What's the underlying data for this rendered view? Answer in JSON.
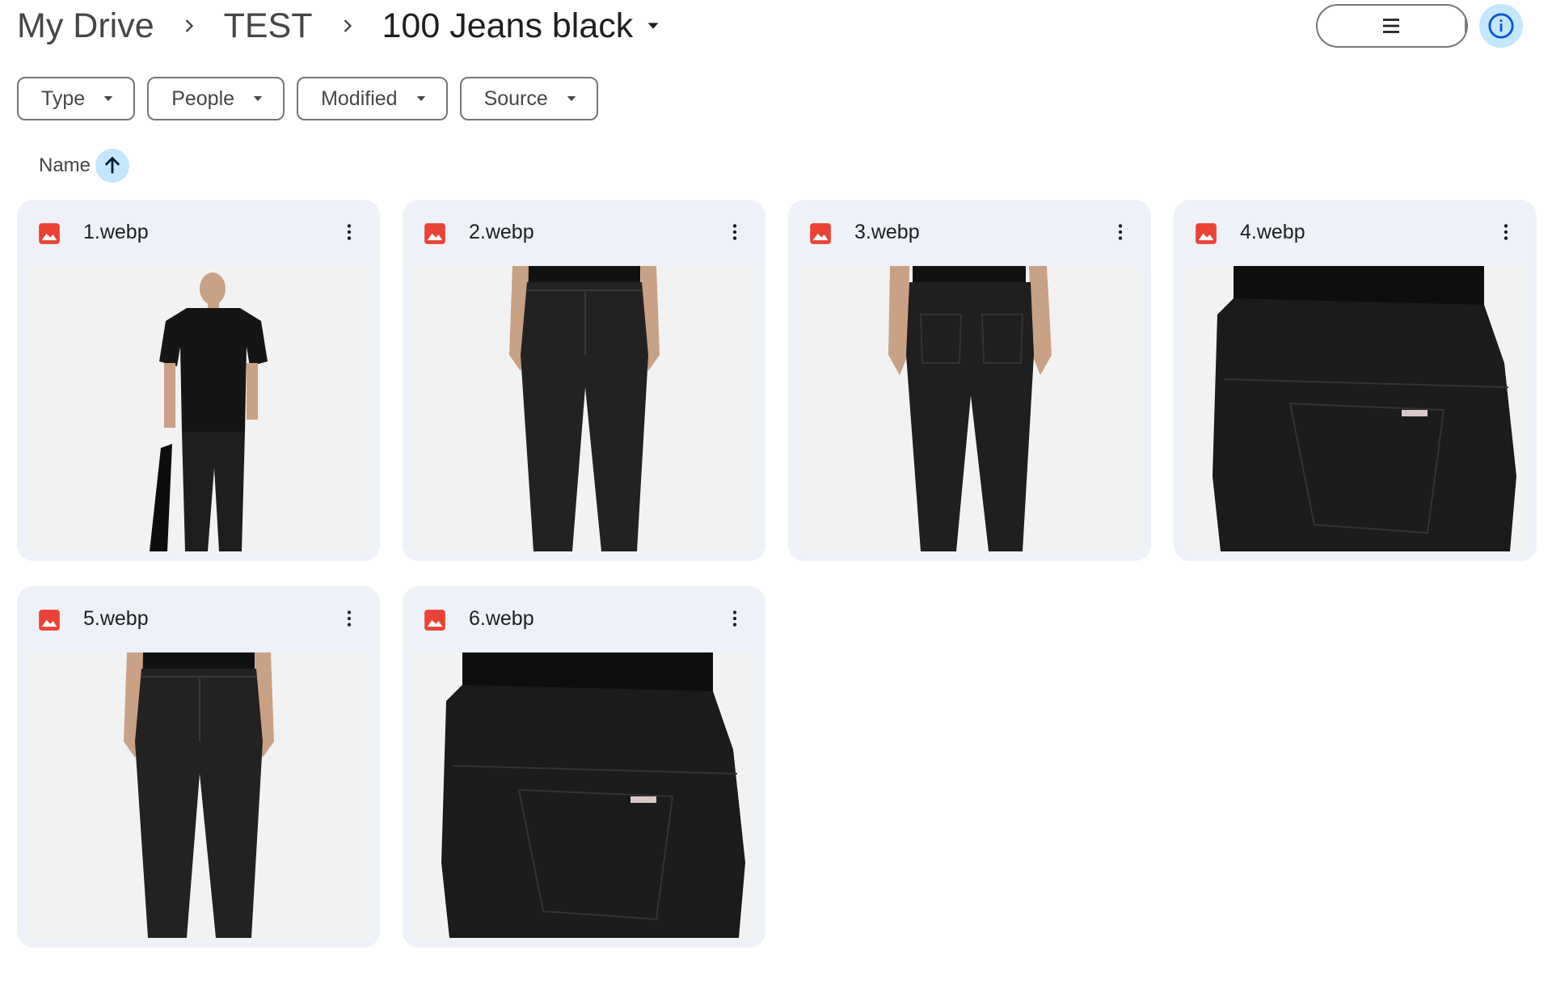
{
  "breadcrumb": {
    "items": [
      "My Drive",
      "TEST"
    ],
    "current": "100 Jeans black"
  },
  "view_toggle": {
    "list_icon": "list-icon",
    "grid_icon": "grid-icon",
    "selected": "grid"
  },
  "info_icon": "info-icon",
  "filters": [
    {
      "label": "Type"
    },
    {
      "label": "People"
    },
    {
      "label": "Modified"
    },
    {
      "label": "Source"
    }
  ],
  "sort": {
    "label": "Name",
    "direction": "ascending"
  },
  "files": [
    {
      "name": "1.webp",
      "thumb": "full-body"
    },
    {
      "name": "2.webp",
      "thumb": "front-jeans"
    },
    {
      "name": "3.webp",
      "thumb": "back-jeans"
    },
    {
      "name": "4.webp",
      "thumb": "back-pocket-closeup"
    },
    {
      "name": "5.webp",
      "thumb": "front-jeans"
    },
    {
      "name": "6.webp",
      "thumb": "back-pocket-closeup"
    }
  ],
  "colors": {
    "accent": "#c2e7ff",
    "card": "#eef1f7",
    "image_icon": "#ea4335"
  }
}
